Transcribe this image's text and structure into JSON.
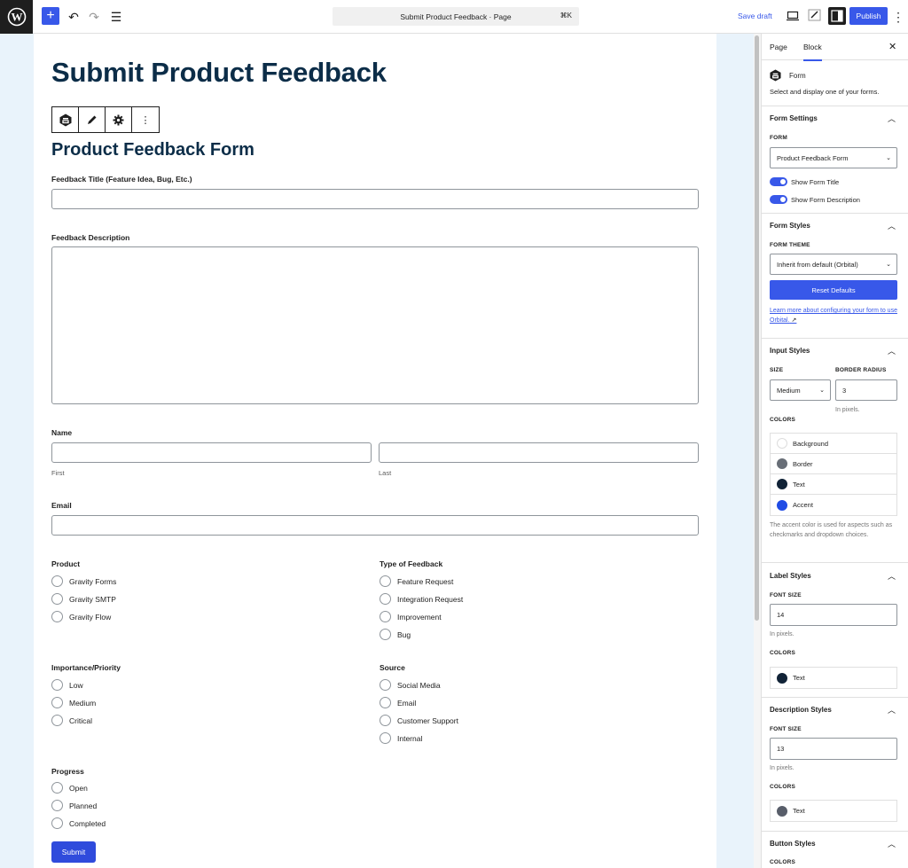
{
  "topbar": {
    "add_label": "+",
    "undo": "↶",
    "redo": "↷",
    "list_view": "☰",
    "command_title": "Submit Product Feedback · Page",
    "command_shortcut": "⌘K",
    "save_draft": "Save draft",
    "publish": "Publish",
    "more": "⋮"
  },
  "page": {
    "title": "Submit Product Feedback"
  },
  "block_toolbar": {
    "more": "⋮"
  },
  "form": {
    "title": "Product Feedback Form",
    "feedback_title_label": "Feedback Title (Feature Idea, Bug, Etc.)",
    "feedback_description_label": "Feedback Description",
    "name_label": "Name",
    "name_first": "First",
    "name_last": "Last",
    "email_label": "Email",
    "product_label": "Product",
    "product_options": [
      "Gravity Forms",
      "Gravity SMTP",
      "Gravity Flow"
    ],
    "type_label": "Type of Feedback",
    "type_options": [
      "Feature Request",
      "Integration Request",
      "Improvement",
      "Bug"
    ],
    "priority_label": "Importance/Priority",
    "priority_options": [
      "Low",
      "Medium",
      "Critical"
    ],
    "source_label": "Source",
    "source_options": [
      "Social Media",
      "Email",
      "Customer Support",
      "Internal"
    ],
    "progress_label": "Progress",
    "progress_options": [
      "Open",
      "Planned",
      "Completed"
    ],
    "submit": "Submit"
  },
  "sidebar": {
    "tab_page": "Page",
    "tab_block": "Block",
    "close": "✕",
    "block_name": "Form",
    "block_description": "Select and display one of your forms.",
    "form_settings": {
      "heading": "Form Settings",
      "form_label": "FORM",
      "form_value": "Product Feedback Form",
      "show_title": "Show Form Title",
      "show_description": "Show Form Description"
    },
    "form_styles": {
      "heading": "Form Styles",
      "theme_label": "FORM THEME",
      "theme_value": "Inherit from default (Orbital)",
      "reset": "Reset Defaults",
      "learn_more": "Learn more about configuring your form to use Orbital."
    },
    "input_styles": {
      "heading": "Input Styles",
      "size_label": "SIZE",
      "size_value": "Medium",
      "radius_label": "BORDER RADIUS",
      "radius_value": "3",
      "radius_hint": "In pixels.",
      "colors_label": "COLORS",
      "colors": [
        {
          "name": "Background",
          "color": "#ffffff"
        },
        {
          "name": "Border",
          "color": "#686e77"
        },
        {
          "name": "Text",
          "color": "#112337"
        },
        {
          "name": "Accent",
          "color": "#204ce5"
        }
      ],
      "accent_note": "The accent color is used for aspects such as checkmarks and dropdown choices."
    },
    "label_styles": {
      "heading": "Label Styles",
      "font_size_label": "FONT SIZE",
      "font_size_value": "14",
      "hint": "In pixels.",
      "colors_label": "COLORS",
      "color_name": "Text",
      "color": "#112337"
    },
    "description_styles": {
      "heading": "Description Styles",
      "font_size_label": "FONT SIZE",
      "font_size_value": "13",
      "hint": "In pixels.",
      "colors_label": "COLORS",
      "color_name": "Text",
      "color": "#585e6a"
    },
    "button_styles": {
      "heading": "Button Styles",
      "colors_label": "COLORS"
    }
  }
}
